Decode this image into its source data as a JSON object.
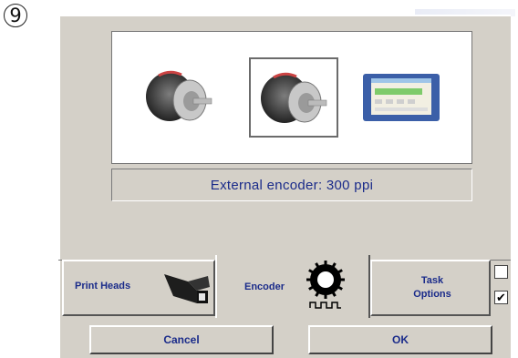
{
  "step_number": "9",
  "options": [
    {
      "icon": "encoder-icon",
      "selected": false
    },
    {
      "icon": "encoder-icon",
      "selected": true
    },
    {
      "icon": "screen-icon",
      "selected": false
    }
  ],
  "status_text": "External encoder: 300 ppi",
  "tabs": [
    {
      "label": "Print Heads",
      "icon": "print-head-icon"
    },
    {
      "label": "Encoder",
      "icon": "encoder-wheel-icon",
      "active": true
    },
    {
      "label": "Task Options"
    }
  ],
  "task_checkboxes": [
    {
      "checked": false,
      "mark": ""
    },
    {
      "checked": true,
      "mark": "✔"
    }
  ],
  "buttons": {
    "cancel": "Cancel",
    "ok": "OK"
  }
}
